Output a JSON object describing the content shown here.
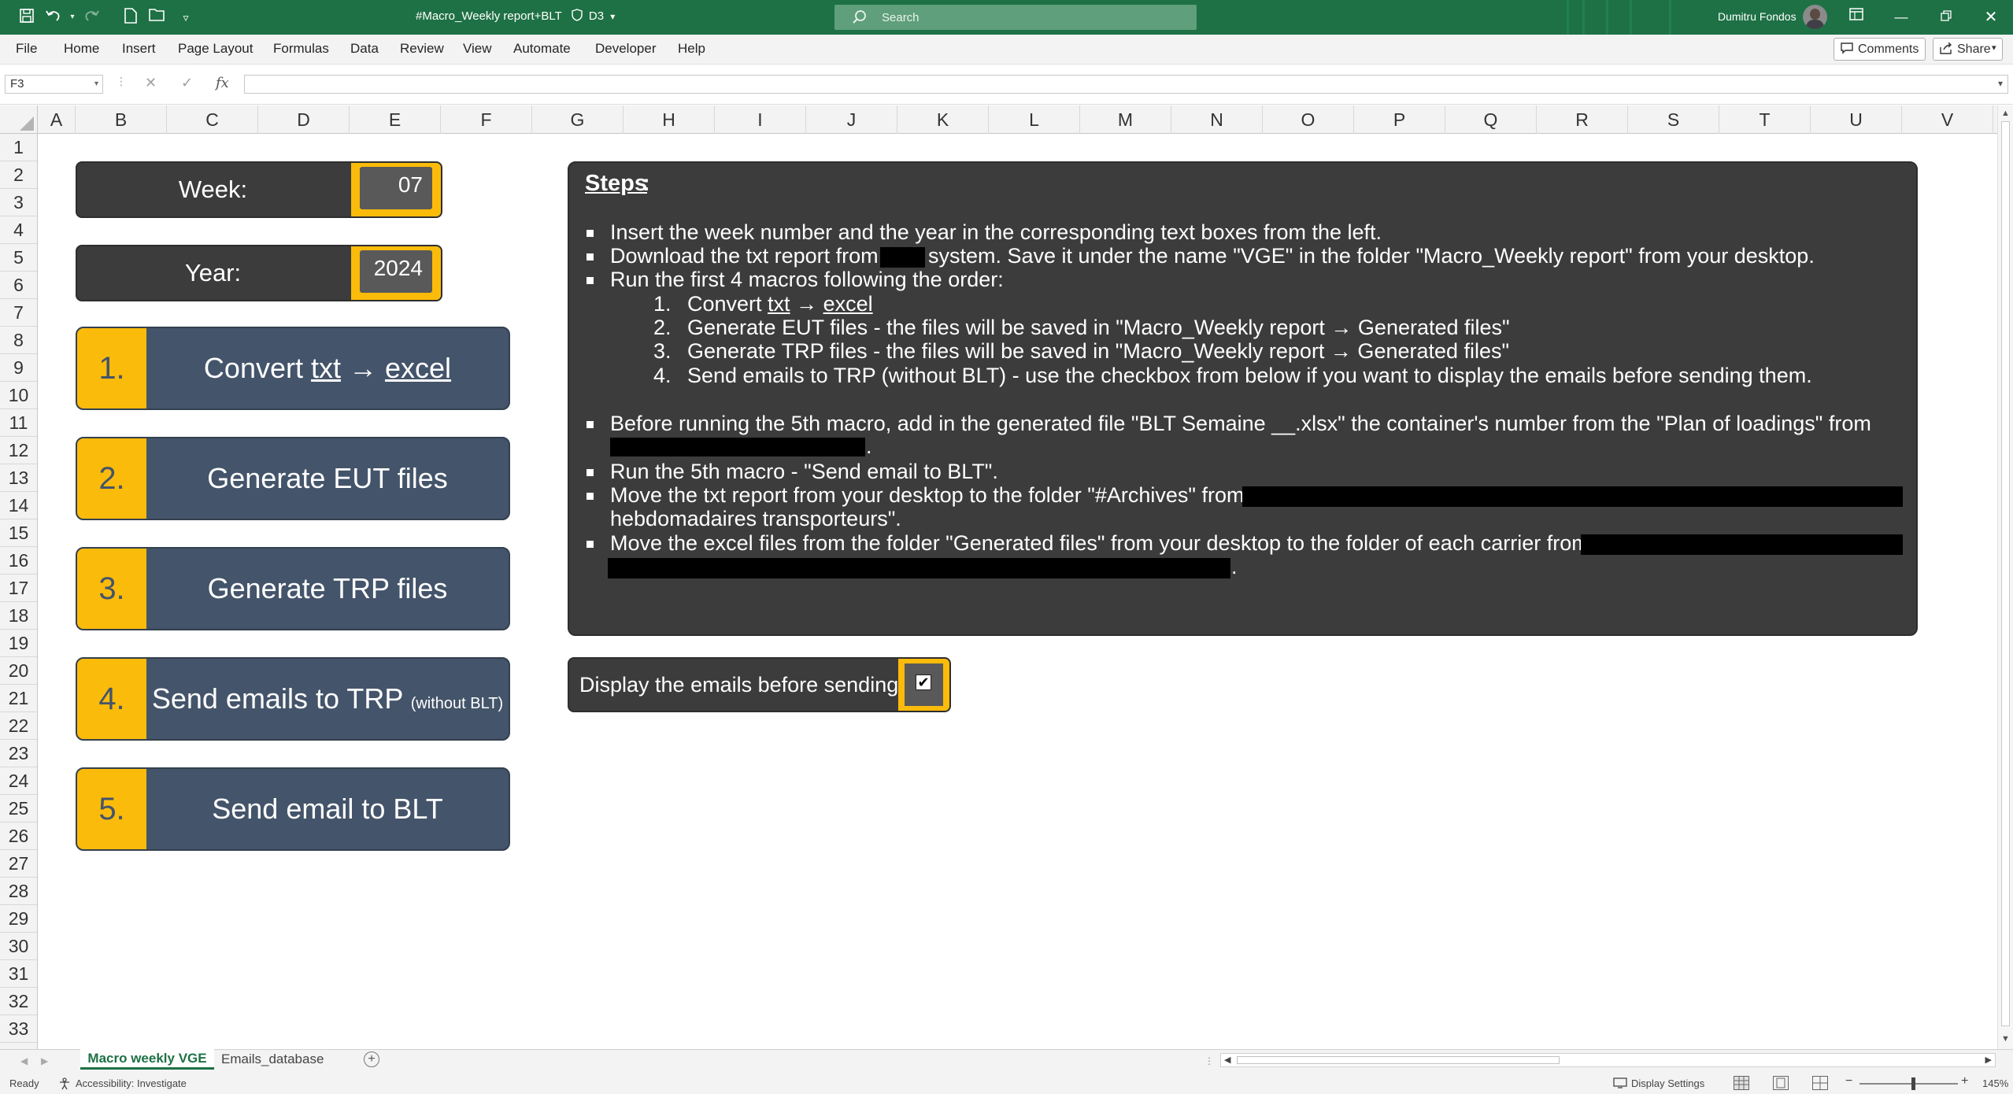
{
  "titlebar": {
    "doc_title": "#Macro_Weekly report+BLT",
    "label_tag": "D3",
    "search_placeholder": "Search",
    "user_name": "Dumitru Fondos",
    "accent_color": "#1e7145"
  },
  "ribbon": {
    "tabs": [
      "File",
      "Home",
      "Insert",
      "Page Layout",
      "Formulas",
      "Data",
      "Review",
      "View",
      "Automate",
      "Developer",
      "Help"
    ],
    "comments_label": "Comments",
    "share_label": "Share"
  },
  "formula_bar": {
    "name_box": "F3",
    "formula": ""
  },
  "grid": {
    "columns": [
      "A",
      "B",
      "C",
      "D",
      "E",
      "F",
      "G",
      "H",
      "I",
      "J",
      "K",
      "L",
      "M",
      "N",
      "O",
      "P",
      "Q",
      "R",
      "S",
      "T",
      "U",
      "V"
    ],
    "rows": [
      "1",
      "2",
      "3",
      "4",
      "5",
      "6",
      "7",
      "8",
      "9",
      "10",
      "11",
      "12",
      "13",
      "14",
      "15",
      "16",
      "17",
      "18",
      "19",
      "20",
      "21",
      "22",
      "23",
      "24",
      "25",
      "26",
      "27",
      "28",
      "29",
      "30",
      "31",
      "32",
      "33"
    ]
  },
  "inputs": {
    "week_label": "Week:",
    "week_value": "07",
    "year_label": "Year:",
    "year_value": "2024"
  },
  "macros": [
    {
      "num": "1.",
      "label_pre": "Convert ",
      "label_u1": "txt",
      "label_mid": " → ",
      "label_u2": "excel"
    },
    {
      "num": "2.",
      "label": "Generate EUT files"
    },
    {
      "num": "3.",
      "label": "Generate TRP files"
    },
    {
      "num": "4.",
      "label": "Send emails to TRP",
      "label_small": "(without BLT)"
    },
    {
      "num": "5.",
      "label": "Send email to BLT"
    }
  ],
  "steps": {
    "title": "Steps",
    "colon": ":",
    "s1": "Insert the week number and the year in the corresponding text boxes from the left.",
    "s2_a": "Download the txt report from",
    "s2_b": "system. Save it under the name \"VGE\" in the folder \"Macro_Weekly report\" from your desktop.",
    "s3": "Run the first 4 macros following the order:",
    "sub1_num": "1.",
    "sub1_a": "Convert ",
    "sub1_u1": "txt",
    "sub1_mid": " → ",
    "sub1_u2": "excel",
    "sub2_num": "2.",
    "sub2": "Generate EUT files - the files will be saved in \"Macro_Weekly report → Generated files\"",
    "sub3_num": "3.",
    "sub3": "Generate TRP files - the files will be saved in \"Macro_Weekly report → Generated files\"",
    "sub4_num": "4.",
    "sub4": "Send emails to TRP (without BLT) - use the checkbox from below if you want to display the emails before sending them.",
    "s4": "Before running the 5th macro, add in the generated file \"BLT Semaine __.xlsx\" the container's number from the \"Plan of loadings\" from",
    "s4_end": ".",
    "s5": "Run the 5th macro - \"Send email to BLT\".",
    "s6_a": "Move the txt report from your desktop to the folder \"#Archives\" from",
    "s6_b": "hebdomadaires transporteurs\".",
    "s7": "Move the excel files from the folder \"Generated files\" from your desktop to the folder of each carrier from",
    "s7_end": "."
  },
  "display_emails": {
    "label": "Display the emails before sending:",
    "checked": true,
    "check_glyph": "✔"
  },
  "sheets": {
    "active": "Macro weekly VGE",
    "other": "Emails_database"
  },
  "status": {
    "ready": "Ready",
    "accessibility": "Accessibility: Investigate",
    "display_settings": "Display Settings",
    "zoom": "145%"
  },
  "colors": {
    "panel": "#3c3c3c",
    "button": "#44546a",
    "accent_yellow": "#fbbb0a"
  }
}
